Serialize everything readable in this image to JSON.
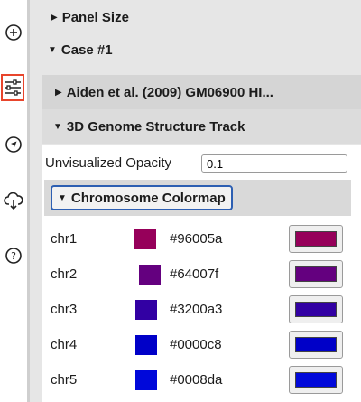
{
  "rail": {
    "icons": [
      "plus-circle-icon",
      "sliders-icon",
      "navigation-arrow-icon",
      "cloud-download-icon",
      "help-circle-icon"
    ],
    "active_icon": "sliders-icon",
    "active_border_color": "#e8452c"
  },
  "panel_size": {
    "label": "Panel Size",
    "expanded": false
  },
  "case": {
    "label": "Case #1",
    "expanded": true
  },
  "tracks": [
    {
      "label": "Aiden et al. (2009) GM06900 HI...",
      "expanded": false
    },
    {
      "label": "3D Genome Structure Track",
      "expanded": true
    }
  ],
  "opacity": {
    "label": "Unvisualized Opacity",
    "value": "0.1"
  },
  "colormap": {
    "label": "Chromosome Colormap",
    "expanded": true,
    "entries": [
      {
        "name": "chr1",
        "hex": "#96005a"
      },
      {
        "name": "chr2",
        "hex": "#64007f"
      },
      {
        "name": "chr3",
        "hex": "#3200a3"
      },
      {
        "name": "chr4",
        "hex": "#0000c8"
      },
      {
        "name": "chr5",
        "hex": "#0008da"
      }
    ]
  }
}
